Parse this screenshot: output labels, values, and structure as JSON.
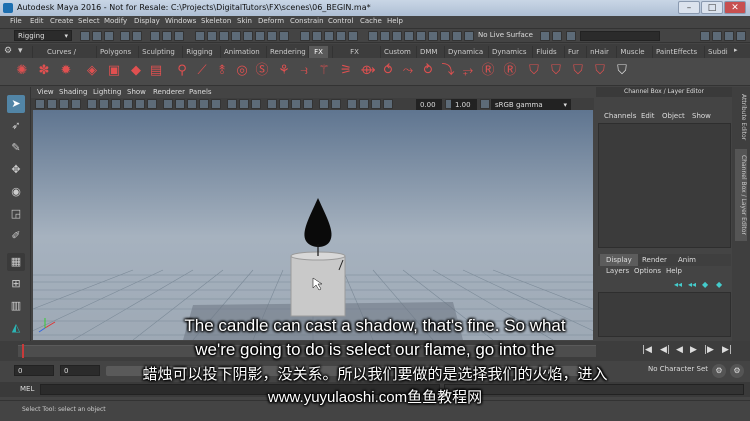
{
  "window": {
    "title": "Autodesk Maya 2016 - Not for Resale: C:\\Projects\\DigitalTutors\\FX\\scenes\\06_BEGIN.ma*"
  },
  "menubar": [
    "File",
    "Edit",
    "Create",
    "Select",
    "Modify",
    "Display",
    "Windows",
    "Skeleton",
    "Skin",
    "Deform",
    "Constrain",
    "Control",
    "Cache",
    "Help"
  ],
  "status_line": {
    "menu_set": "Rigging",
    "live_surface": "No Live Surface"
  },
  "shelf_tabs": [
    "Curves / Surfaces",
    "Polygons",
    "Sculpting",
    "Rigging",
    "Animation",
    "Rendering",
    "FX",
    "FX Caching",
    "Custom",
    "DMM",
    "Dynamica",
    "Dynamics",
    "Fluids",
    "Fur",
    "nHair",
    "Muscle",
    "PaintEffects",
    "Subdi"
  ],
  "shelf_active_tab": "FX",
  "panel_menu": [
    "View",
    "Shading",
    "Lighting",
    "Show",
    "Renderer",
    "Panels"
  ],
  "panel_toolbar": {
    "exposure": "0.00",
    "gamma": "1.00",
    "color_space": "sRGB gamma"
  },
  "channel_box": {
    "title": "Channel Box / Layer Editor",
    "menu": [
      "Channels",
      "Edit",
      "Object",
      "Show"
    ]
  },
  "side_tabs": [
    "Attribute Editor",
    "Channel Box / Layer Editor"
  ],
  "layer_editor": {
    "tabs": [
      "Display",
      "Render",
      "Anim"
    ],
    "active_tab": "Display",
    "menu": [
      "Layers",
      "Options",
      "Help"
    ]
  },
  "time_slider": {
    "current_frame": "1",
    "range_start": "0",
    "range_inner_start": "0",
    "character_set": "No Character Set"
  },
  "command_line": {
    "label": "MEL"
  },
  "help_line": {
    "text": "Select Tool: select an object"
  },
  "subtitles": {
    "line1": "The candle can cast a shadow, that's fine. So what",
    "line2": "we're going to do is select our flame, go into the",
    "line3": "蜡烛可以投下阴影，没关系。所以我们要做的是选择我们的火焰，进入",
    "line4": "www.yuyulaoshi.com鱼鱼教程网"
  },
  "colors": {
    "ui_bg": "#444444",
    "shelf_icon": "#e05050",
    "viewport_top": "#5f7590",
    "viewport_bottom": "#a6b2bf",
    "time_marker": "#c93a3a"
  }
}
